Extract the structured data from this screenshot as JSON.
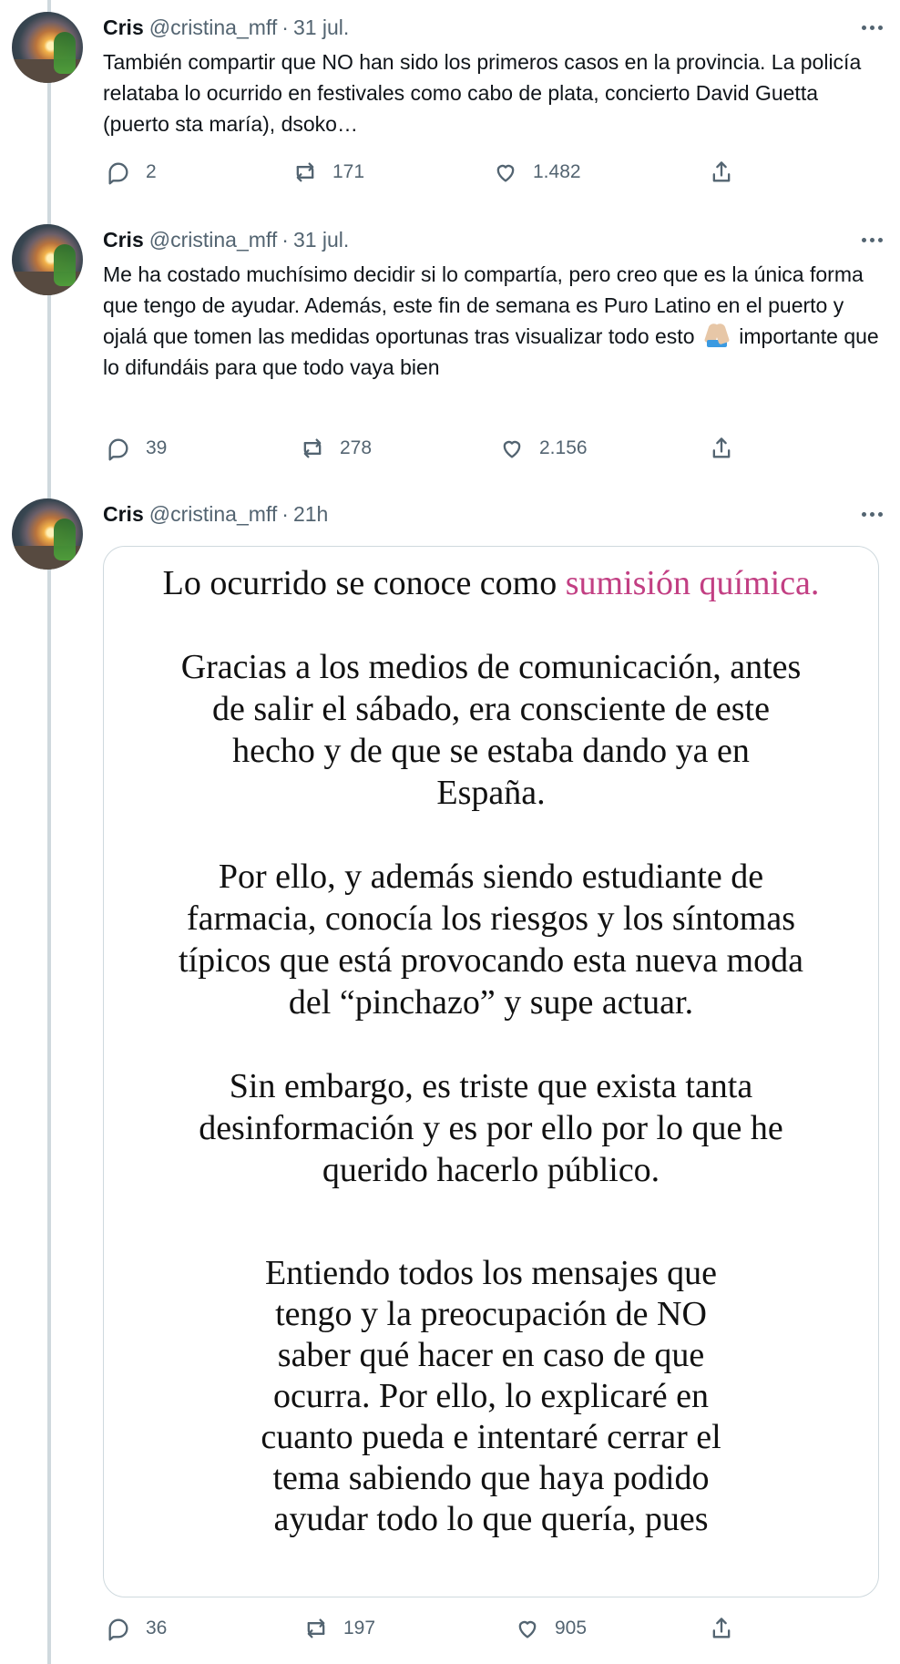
{
  "colors": {
    "accent": "#c23f83",
    "secondary_text": "#536471",
    "thread_line": "#cfd9de"
  },
  "tweets": [
    {
      "name": "Cris",
      "handle": "@cristina_mff",
      "separator": "·",
      "time": "31 jul.",
      "text": "También compartir que NO han sido los primeros casos en la provincia. La policía relataba lo ocurrido en festivales como cabo de plata, concierto David Guetta (puerto sta maría), dsoko…",
      "replies": "2",
      "retweets": "171",
      "likes": "1.482"
    },
    {
      "name": "Cris",
      "handle": "@cristina_mff",
      "separator": "·",
      "time": "31 jul.",
      "text_before_emoji": "Me ha costado muchísimo decidir si lo compartía, pero creo que es la única forma que tengo de ayudar. Además, este fin de semana es Puro Latino en el puerto y ojalá que tomen las medidas oportunas tras visualizar todo esto",
      "text_after_emoji": "importante que lo difundáis para que todo vaya bien",
      "emoji": "folded-hands",
      "replies": "39",
      "retweets": "278",
      "likes": "2.156"
    },
    {
      "name": "Cris",
      "handle": "@cristina_mff",
      "separator": "·",
      "time": "21h",
      "image_text": {
        "p1_before": "Lo ocurrido se conoce como",
        "p1_accent": "sumisión química.",
        "p2": "Gracias a los medios de comunicación, antes de salir el sábado, era consciente de este hecho y de que se estaba dando ya en España.",
        "p3": "Por ello, y además siendo estudiante de farmacia, conocía los riesgos y los síntomas típicos que está provocando esta nueva moda del “pinchazo” y supe actuar.",
        "p4": "Sin embargo, es triste que exista tanta desinformación y es por ello por lo que he querido hacerlo público.",
        "p5": "Entiendo todos los mensajes que tengo y la preocupación de NO saber qué hacer en caso de que ocurra. Por ello, lo explicaré en cuanto pueda e intentaré cerrar el tema sabiendo que haya podido ayudar todo lo que quería, pues"
      },
      "replies": "36",
      "retweets": "197",
      "likes": "905"
    }
  ]
}
